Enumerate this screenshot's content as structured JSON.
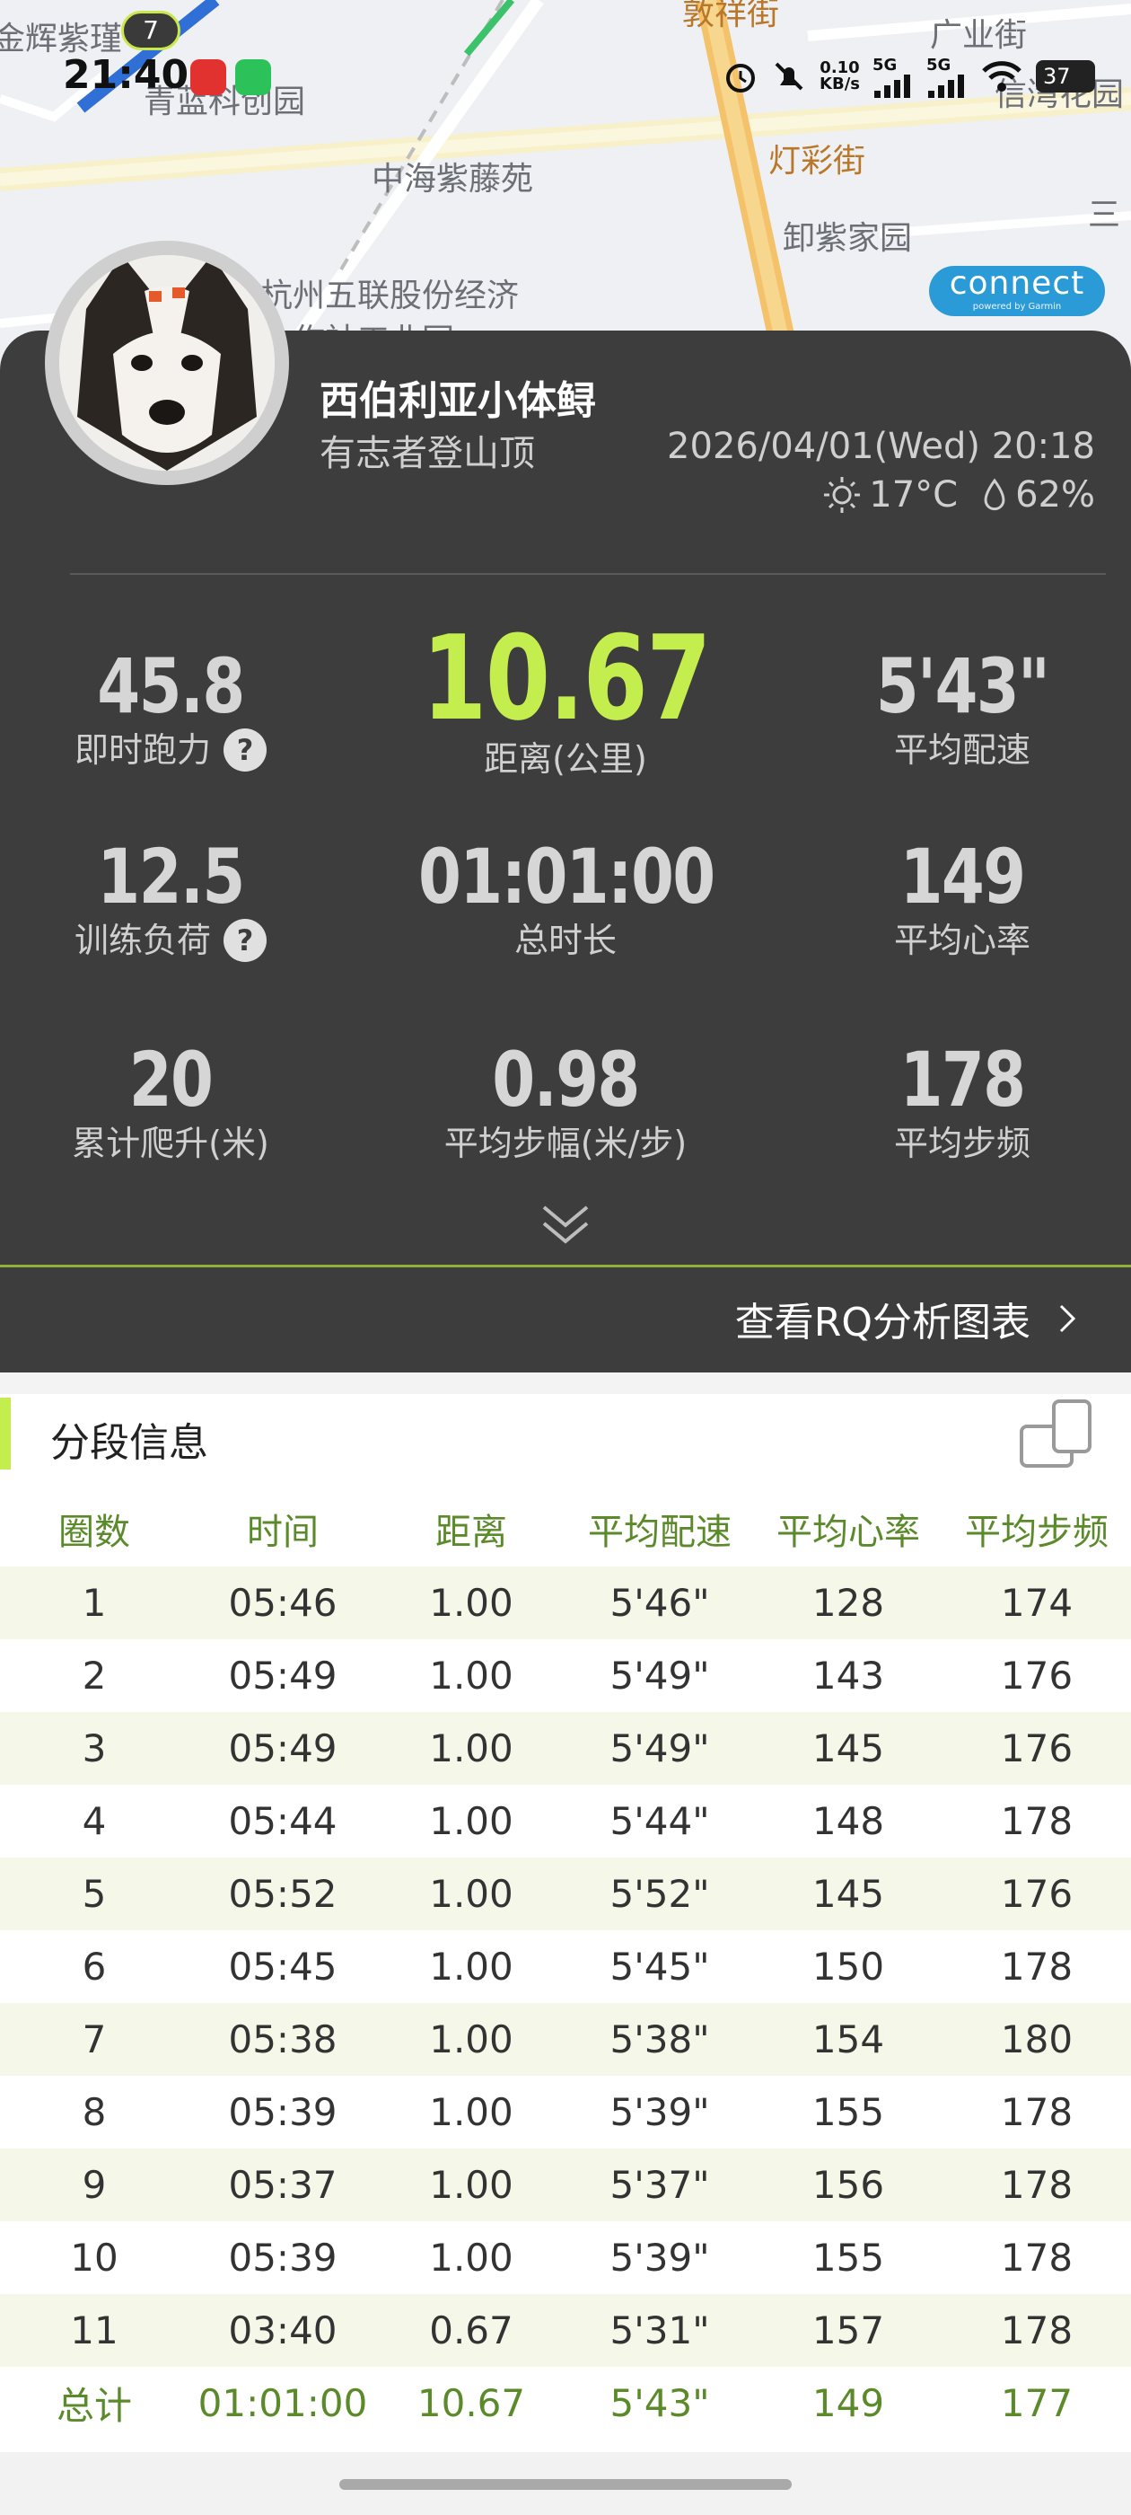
{
  "status_bar": {
    "time": "21:40",
    "notification_count": "7",
    "net_speed": "0.10",
    "net_unit": "KB/s",
    "signal1": "5G",
    "signal2": "5G",
    "battery": "37"
  },
  "map": {
    "labels": [
      "金辉紫瑾",
      "青蓝科创园",
      "中海紫藤苑",
      "灯彩街",
      "卸紫家园",
      "杭州五联股份经济",
      "合作社工业园",
      "广业街",
      "信湾花园",
      "敦祥街",
      "三"
    ],
    "badge_text": "connect",
    "badge_sub": "powered by Garmin"
  },
  "profile": {
    "name": "西伯利亚小体鲟",
    "level": "有志者登山顶",
    "datetime": "2026/04/01(Wed) 20:18",
    "temperature": "17°C",
    "humidity": "62%"
  },
  "metrics": [
    {
      "value": "45.8",
      "label": "即时跑力",
      "help": true
    },
    {
      "value": "10.67",
      "label": "距离(公里)",
      "help": false
    },
    {
      "value": "5'43\"",
      "label": "平均配速",
      "help": false
    },
    {
      "value": "12.5",
      "label": "训练负荷",
      "help": true
    },
    {
      "value": "01:01:00",
      "label": "总时长",
      "help": false
    },
    {
      "value": "149",
      "label": "平均心率",
      "help": false
    },
    {
      "value": "20",
      "label": "累计爬升(米)",
      "help": false
    },
    {
      "value": "0.98",
      "label": "平均步幅(米/步)",
      "help": false
    },
    {
      "value": "178",
      "label": "平均步频",
      "help": false
    }
  ],
  "rq_link": "查看RQ分析图表",
  "splits": {
    "title": "分段信息",
    "headers": [
      "圈数",
      "时间",
      "距离",
      "平均配速",
      "平均心率",
      "平均步频"
    ],
    "rows": [
      [
        "1",
        "05:46",
        "1.00",
        "5'46\"",
        "128",
        "174"
      ],
      [
        "2",
        "05:49",
        "1.00",
        "5'49\"",
        "143",
        "176"
      ],
      [
        "3",
        "05:49",
        "1.00",
        "5'49\"",
        "145",
        "176"
      ],
      [
        "4",
        "05:44",
        "1.00",
        "5'44\"",
        "148",
        "178"
      ],
      [
        "5",
        "05:52",
        "1.00",
        "5'52\"",
        "145",
        "176"
      ],
      [
        "6",
        "05:45",
        "1.00",
        "5'45\"",
        "150",
        "178"
      ],
      [
        "7",
        "05:38",
        "1.00",
        "5'38\"",
        "154",
        "180"
      ],
      [
        "8",
        "05:39",
        "1.00",
        "5'39\"",
        "155",
        "178"
      ],
      [
        "9",
        "05:37",
        "1.00",
        "5'37\"",
        "156",
        "178"
      ],
      [
        "10",
        "05:39",
        "1.00",
        "5'39\"",
        "155",
        "178"
      ],
      [
        "11",
        "03:40",
        "0.67",
        "5'31\"",
        "157",
        "178"
      ]
    ],
    "total": [
      "总计",
      "01:01:00",
      "10.67",
      "5'43\"",
      "149",
      "177"
    ]
  },
  "colors": {
    "accent": "#c4ee4e",
    "card_bg": "#3d3d3d",
    "table_accent": "#5b8a2a",
    "row_stripe": "#f5f8e8"
  }
}
